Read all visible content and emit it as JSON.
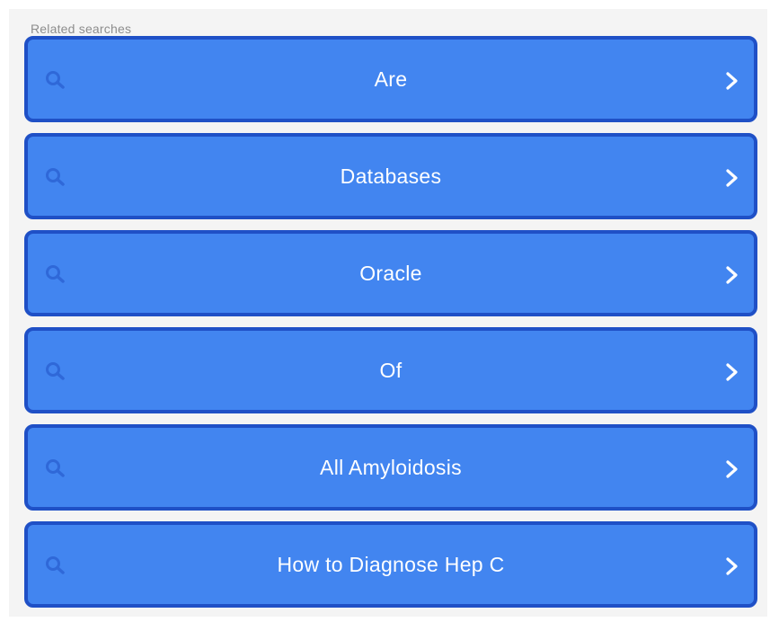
{
  "header": {
    "title": "Related searches"
  },
  "items": [
    {
      "label": "Are",
      "icon": "search-icon",
      "action_icon": "chevron-right-icon"
    },
    {
      "label": "Databases",
      "icon": "search-icon",
      "action_icon": "chevron-right-icon"
    },
    {
      "label": "Oracle",
      "icon": "search-icon",
      "action_icon": "chevron-right-icon"
    },
    {
      "label": "Of",
      "icon": "search-icon",
      "action_icon": "chevron-right-icon"
    },
    {
      "label": "All Amyloidosis",
      "icon": "search-icon",
      "action_icon": "chevron-right-icon"
    },
    {
      "label": "How to Diagnose Hep C",
      "icon": "search-icon",
      "action_icon": "chevron-right-icon"
    }
  ],
  "colors": {
    "button_fill": "#4285f0",
    "button_border": "#1f50c6",
    "search_icon": "#2f68d8",
    "text": "#ffffff",
    "header_text": "#8d8d8d",
    "panel_bg": "#f4f4f4"
  }
}
